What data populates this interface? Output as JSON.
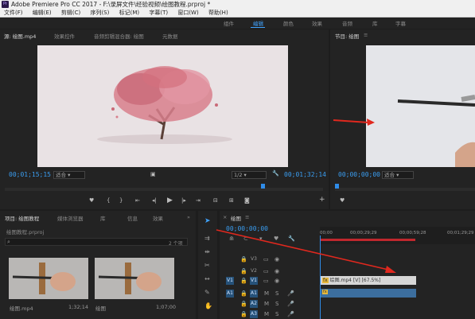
{
  "window": {
    "title": "Adobe Premiere Pro CC 2017 - F:\\录屏文件\\经验视频\\绘图教程.prproj *",
    "icon": "Pr"
  },
  "menu": [
    "文件(F)",
    "编辑(E)",
    "剪辑(C)",
    "序列(S)",
    "标记(M)",
    "字幕(T)",
    "窗口(W)",
    "帮助(H)"
  ],
  "workspaces": [
    "组件",
    "编辑",
    "颜色",
    "效果",
    "音频",
    "库",
    "字幕"
  ],
  "source": {
    "tabs": [
      "源: 绘图.mp4",
      "效果控件",
      "音频剪辑混合器: 绘图",
      "元数据"
    ],
    "timecode_in": "00;01;15;15",
    "fit": "适合",
    "resolution": "1/2",
    "timecode_duration": "00;01;32;14"
  },
  "program": {
    "tab": "节目: 绘图",
    "timecode": "00;00;00;00",
    "fit": "适合"
  },
  "project": {
    "tabs": [
      "项目: 绘图教程",
      "媒体浏览器",
      "库",
      "信息",
      "效果"
    ],
    "file": "绘图教程.prproj",
    "item_count": "2 个项",
    "items": [
      {
        "name": "绘图.mp4",
        "duration": "1;32;14"
      },
      {
        "name": "绘图",
        "duration": "1;07;00"
      }
    ]
  },
  "timeline": {
    "tab": "绘图",
    "timecode": "00;00;00;00",
    "ruler": [
      "00;00",
      "00;00;29;29",
      "00;00;59;28",
      "00;01;29;29"
    ],
    "video_tracks": [
      "V3",
      "V2",
      "V1"
    ],
    "audio_tracks": [
      "A1",
      "A2",
      "A3"
    ],
    "source_patch": [
      "V1",
      "A1"
    ],
    "clip_label": "绘图.mp4 [V] [67.5%]"
  },
  "colors": {
    "accent": "#2f8ce8",
    "arrow": "#e0281e",
    "video_clip": "#d6d6d6",
    "audio_clip": "#3c6e9e"
  }
}
